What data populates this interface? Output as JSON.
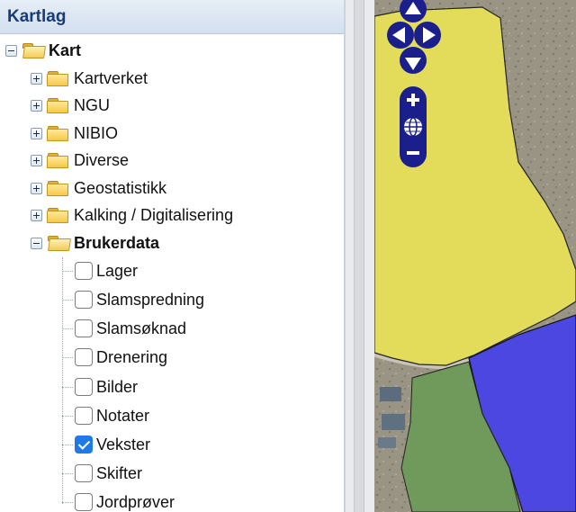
{
  "panel": {
    "title": "Kartlag"
  },
  "tree": {
    "root": {
      "label": "Kart"
    },
    "folders": [
      {
        "label": "Kartverket"
      },
      {
        "label": "NGU"
      },
      {
        "label": "NIBIO"
      },
      {
        "label": "Diverse"
      },
      {
        "label": "Geostatistikk"
      },
      {
        "label": "Kalking / Digitalisering"
      }
    ],
    "open_folder": {
      "label": "Brukerdata"
    },
    "layers": [
      {
        "label": "Lager",
        "checked": false
      },
      {
        "label": "Slamspredning",
        "checked": false
      },
      {
        "label": "Slamsøknad",
        "checked": false
      },
      {
        "label": "Drenering",
        "checked": false
      },
      {
        "label": "Bilder",
        "checked": false
      },
      {
        "label": "Notater",
        "checked": false
      },
      {
        "label": "Vekster",
        "checked": true
      },
      {
        "label": "Skifter",
        "checked": false
      },
      {
        "label": "Jordprøver",
        "checked": false
      }
    ]
  },
  "map": {
    "colors": {
      "field_yellow": "#e3dc5a",
      "field_blue": "#4b47e0",
      "field_green": "#6f9a5c",
      "control_blue": "#1a1f8c"
    },
    "controls": [
      "pan-up-icon",
      "pan-left-icon",
      "pan-right-icon",
      "pan-down-icon",
      "zoom-in-icon",
      "globe-icon",
      "zoom-out-icon"
    ]
  }
}
